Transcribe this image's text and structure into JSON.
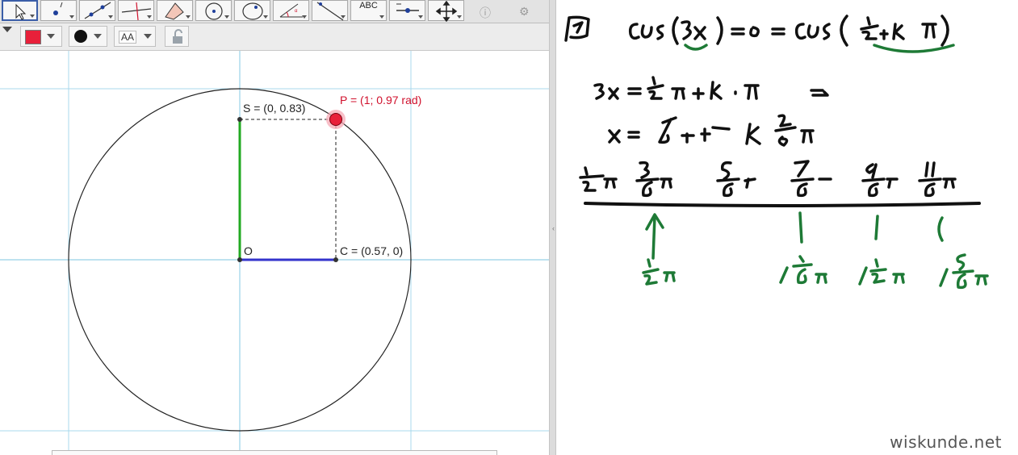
{
  "toolbar": {
    "tools": [
      {
        "name": "move-tool-button",
        "icon": "cursor-arrow-icon"
      },
      {
        "name": "point-tool-button",
        "icon": "point-icon"
      },
      {
        "name": "line-tool-button",
        "icon": "line-through-points-icon"
      },
      {
        "name": "perpendicular-tool-button",
        "icon": "perpendicular-line-icon"
      },
      {
        "name": "polygon-tool-button",
        "icon": "polygon-icon"
      },
      {
        "name": "circle-tool-button",
        "icon": "circle-center-icon"
      },
      {
        "name": "conic-tool-button",
        "icon": "ellipse-icon"
      },
      {
        "name": "angle-tool-button",
        "icon": "angle-icon"
      },
      {
        "name": "reflect-tool-button",
        "icon": "reflect-icon"
      },
      {
        "name": "text-tool-button",
        "icon": "text-icon",
        "label": "ABC"
      },
      {
        "name": "slider-tool-button",
        "icon": "slider-icon"
      },
      {
        "name": "move-view-tool-button",
        "icon": "move-graphics-view-icon"
      }
    ],
    "help_icon": "help-icon",
    "settings_icon": "gear-icon"
  },
  "stylebar": {
    "color": "#e8203a",
    "point_style": "filled-dot-icon",
    "label_style_text": "AA",
    "lock_icon": "padlock-icon"
  },
  "graphics": {
    "points": {
      "S": "S = (0, 0.83)",
      "P": "P = (1; 0.97 rad)",
      "O": "O",
      "C": "C = (0.57, 0)"
    },
    "colors": {
      "sine_segment": "#22aa22",
      "cosine_segment": "#3333cc",
      "point_P": "#e8203a",
      "grid": "#a8d8ec",
      "circle": "#222222"
    }
  },
  "whiteboard": {
    "watermark": "wiskunde.net",
    "ink_colors": {
      "black": "#111111",
      "green": "#1e7a36"
    }
  }
}
